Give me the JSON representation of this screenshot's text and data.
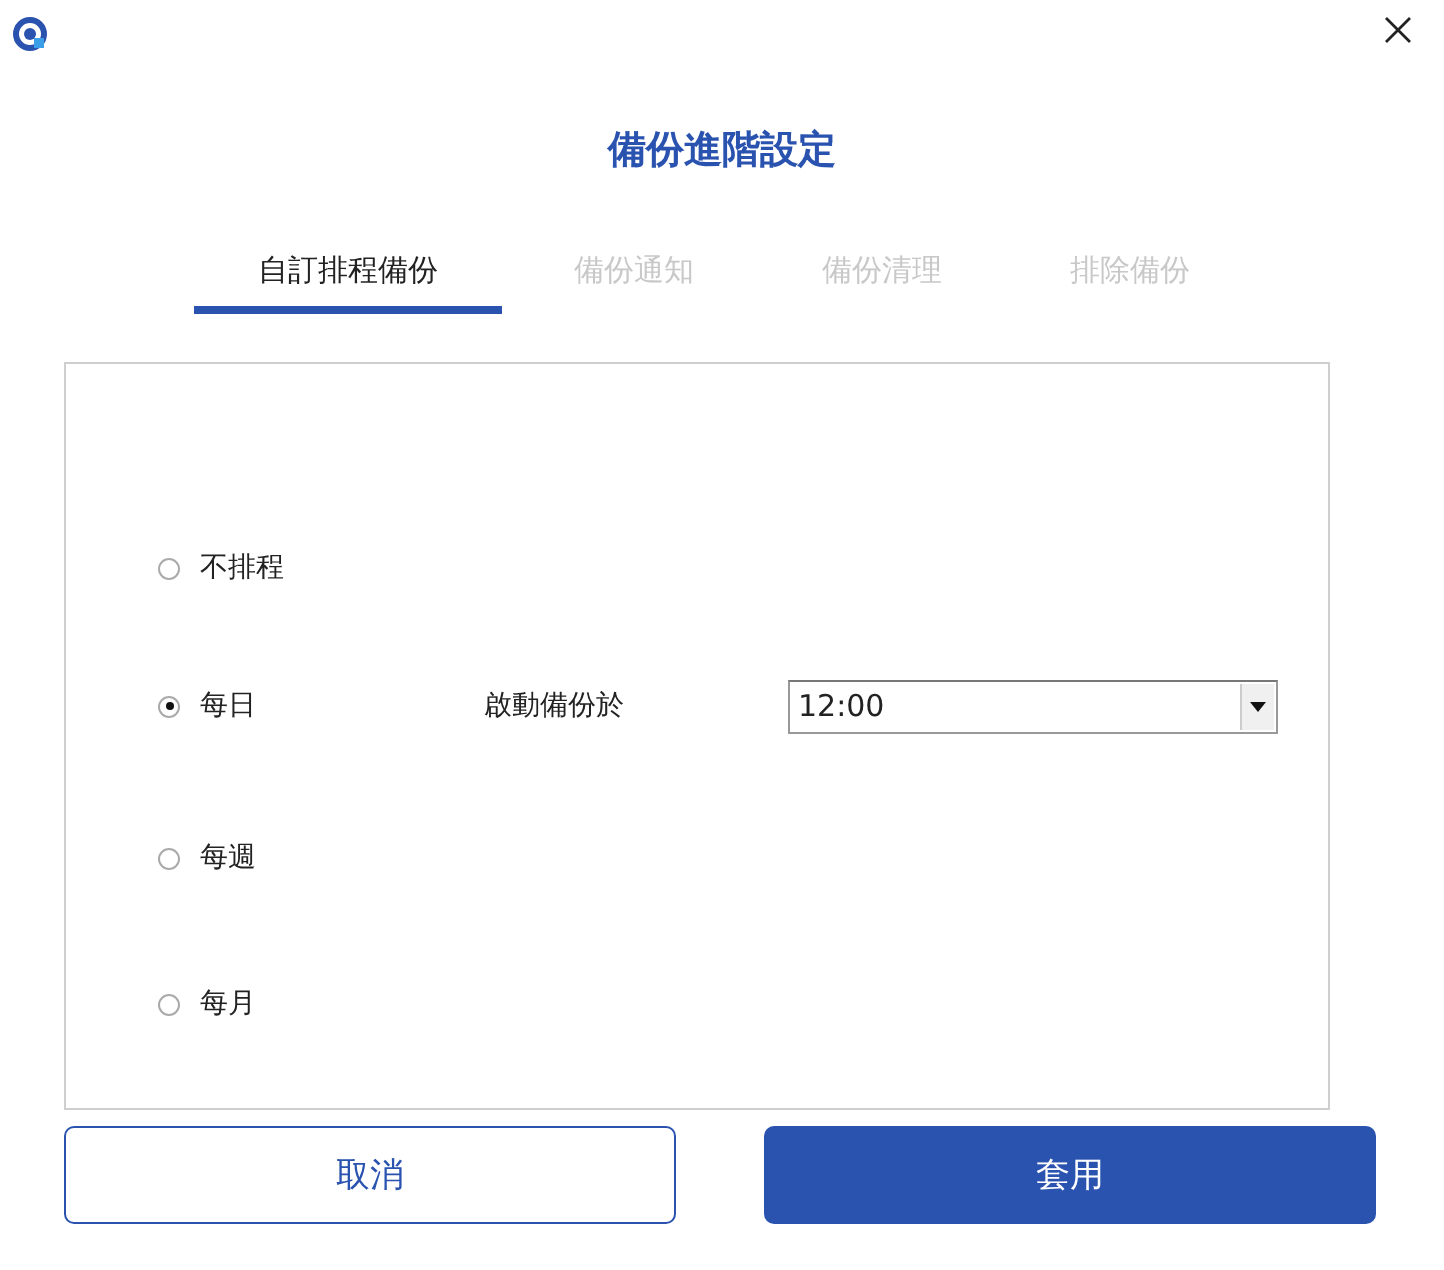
{
  "window": {
    "title": "備份進階設定"
  },
  "tabs": [
    {
      "label": "自訂排程備份",
      "selected": true
    },
    {
      "label": "備份通知",
      "selected": false
    },
    {
      "label": "備份清理",
      "selected": false
    },
    {
      "label": "排除備份",
      "selected": false
    }
  ],
  "schedule_options": [
    {
      "label": "不排程",
      "selected": false
    },
    {
      "label": "每日",
      "selected": true,
      "time_setting": {
        "label": "啟動備份於",
        "value": "12:00"
      }
    },
    {
      "label": "每週",
      "selected": false
    },
    {
      "label": "每月",
      "selected": false
    }
  ],
  "buttons": [
    {
      "label": "取消",
      "kind": "secondary"
    },
    {
      "label": "套用",
      "kind": "primary"
    }
  ]
}
